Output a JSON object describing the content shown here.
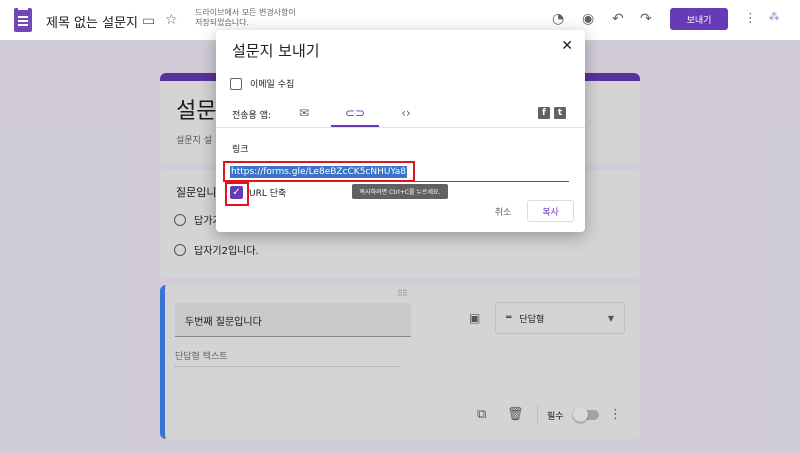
{
  "header": {
    "title": "제목 없는 설문지",
    "save_status": "드라이브에서 모든 변경사항이 저장되었습니다.",
    "send_label": "보내기",
    "icons": [
      "folder-icon",
      "star-icon",
      "palette-icon",
      "eye-icon",
      "undo-icon",
      "redo-icon",
      "more-vert-icon"
    ]
  },
  "form": {
    "title": "설문",
    "description": "설문지 설",
    "q1": {
      "label": "질문입니",
      "options": [
        "답가기",
        "답자기2입니다."
      ]
    },
    "q2": {
      "title": "두번째 질문입니다",
      "type": "단답형",
      "answer_placeholder": "단답형 텍스트",
      "required_label": "필수"
    }
  },
  "dialog": {
    "title": "설문지 보내기",
    "email_label": "이메일 수집",
    "via_label": "전송용 앱:",
    "tabs": [
      "email",
      "link",
      "embed"
    ],
    "link_label": "링크",
    "link_value": "https://forms.gle/Le8eBZcCK5cNHUYa8",
    "shorten_label": "URL 단축",
    "tooltip": "복사하려면 Ctrl+C를 누르세요.",
    "cancel_label": "취소",
    "copy_label": "복사",
    "highlight_color": "#e1131c",
    "accent_color": "#673ab7"
  }
}
